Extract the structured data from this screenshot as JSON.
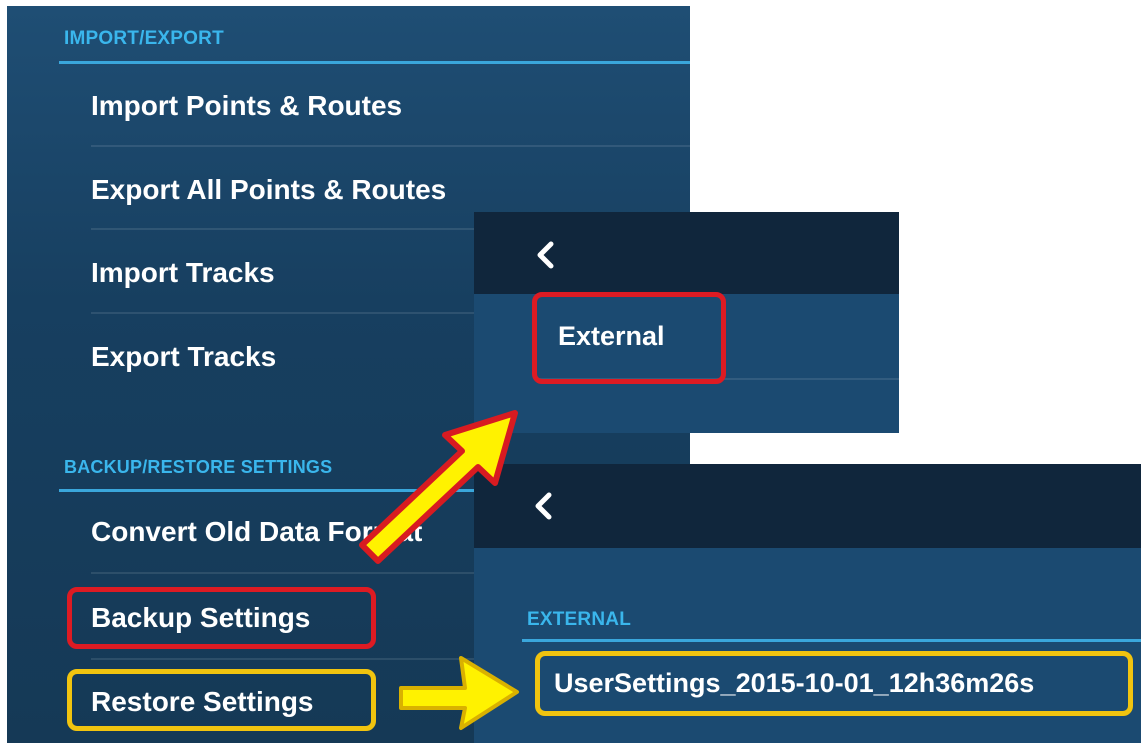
{
  "main_menu": {
    "import_export_header": "IMPORT/EXPORT",
    "items_import_export": [
      "Import Points & Routes",
      "Export All Points & Routes",
      "Import Tracks",
      "Export Tracks"
    ],
    "backup_header": "BACKUP/RESTORE SETTINGS",
    "items_backup": [
      "Convert Old Data Format",
      "Backup Settings",
      "Restore Settings"
    ]
  },
  "backup_popup": {
    "option_label": "External"
  },
  "restore_popup": {
    "section_header": "EXTERNAL",
    "file_label": "UserSettings_2015-10-01_12h36m26s"
  },
  "colors": {
    "panel_blue": "#1a4568",
    "section_header": "#3ab6ec",
    "highlight_red": "#dd1b23",
    "highlight_yellow": "#f1c40f",
    "arrow_yellow": "#fff200"
  }
}
